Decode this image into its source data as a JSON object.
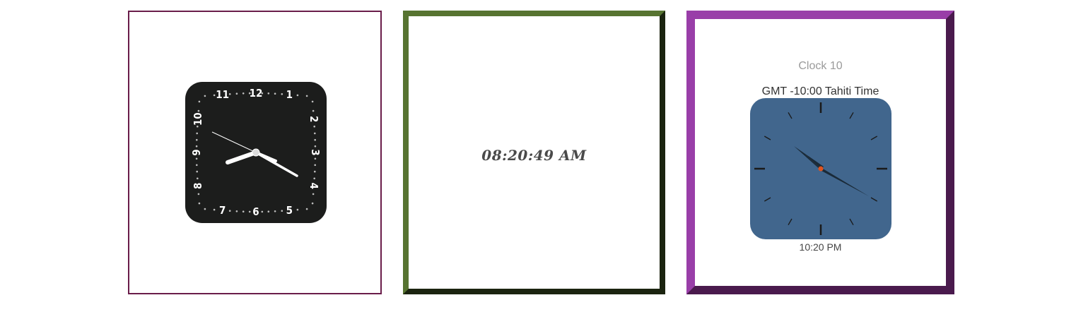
{
  "clock_analog_1": {
    "style": "dark-rounded-square",
    "numerals": [
      "12",
      "1",
      "2",
      "3",
      "4",
      "5",
      "6",
      "7",
      "8",
      "9",
      "10",
      "11"
    ],
    "colors": {
      "face": "#1c1d1c",
      "numerals": "#ffffff",
      "dots": "#bdbdbd",
      "border": "#6a1d4a"
    }
  },
  "clock_digital": {
    "time": "08:20:49 AM",
    "colors": {
      "text": "#4a4a4a",
      "border_light": "#577431",
      "border_dark": "#1b2410"
    }
  },
  "clock_analog_2": {
    "title": "Clock 10",
    "timezone": "GMT -10:00 Tahiti Time",
    "time_label": "10:20 PM",
    "colors": {
      "face": "#41668d",
      "ticks": "#1a1a1a",
      "hands": "#1a2a38",
      "center": "#e0531e",
      "border_light": "#993ea8",
      "border_dark": "#4a1a4d"
    }
  }
}
